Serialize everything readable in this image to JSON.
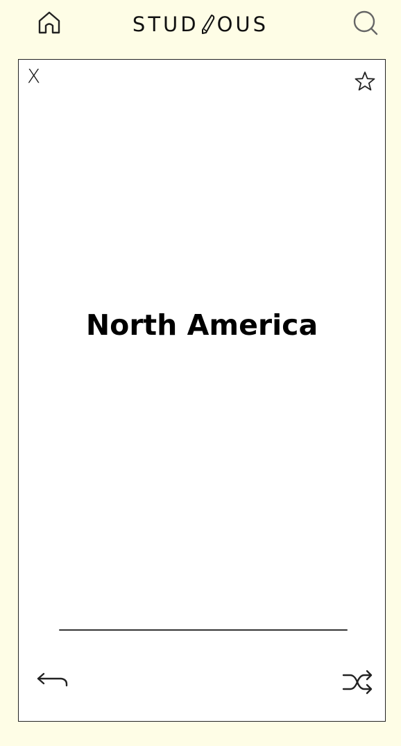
{
  "header": {
    "home_icon": "home-icon",
    "logo_left": "STUD",
    "logo_right": "OUS",
    "logo_pencil_icon": "pencil-icon",
    "search_icon": "search-icon"
  },
  "card": {
    "close_label": "X",
    "star_icon": "star-icon",
    "term": "North America",
    "back_icon": "undo-arrow-icon",
    "shuffle_icon": "shuffle-icon"
  },
  "colors": {
    "page_background": "#fefde6",
    "card_background": "#ffffff",
    "text": "#111111",
    "icon_gray": "#666666"
  }
}
